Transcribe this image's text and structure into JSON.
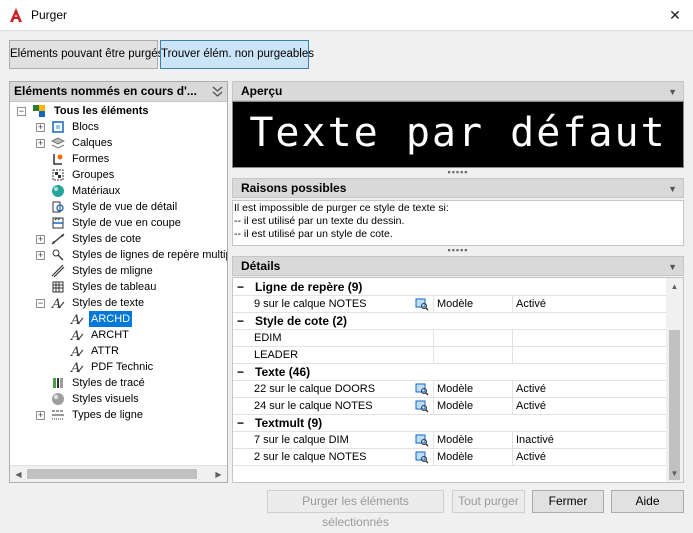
{
  "window": {
    "title": "Purger",
    "close_symbol": "✕"
  },
  "tabs": {
    "purgeable": {
      "pre": "Eléments pouvant être purgés",
      "underline": ""
    },
    "non_purgeable": {
      "label": "Trouver élém. non purgeables"
    }
  },
  "left_panel": {
    "header": "Eléments nommés en cours d'...",
    "root": "Tous les éléments",
    "items": [
      {
        "label": "Blocs"
      },
      {
        "label": "Calques"
      },
      {
        "label": "Formes"
      },
      {
        "label": "Groupes"
      },
      {
        "label": "Matériaux"
      },
      {
        "label": "Style de vue de détail"
      },
      {
        "label": "Style de vue en coupe"
      },
      {
        "label": "Styles de cote"
      },
      {
        "label": "Styles de lignes de repère multiple"
      },
      {
        "label": "Styles de mligne"
      },
      {
        "label": "Styles de tableau"
      },
      {
        "label": "Styles de texte"
      },
      {
        "label": "ARCHD"
      },
      {
        "label": "ARCHT"
      },
      {
        "label": "ATTR"
      },
      {
        "label": "PDF Technic"
      },
      {
        "label": "Styles de tracé"
      },
      {
        "label": "Styles visuels"
      },
      {
        "label": "Types de ligne"
      }
    ]
  },
  "preview": {
    "header": "Aperçu",
    "text": "Texte par défaut"
  },
  "reasons": {
    "header": "Raisons possibles",
    "line1": "Il est impossible de purger ce style de texte si:",
    "line2": "-- il est utilisé par un texte du dessin.",
    "line3": "-- il est utilisé par un style de cote."
  },
  "details": {
    "header": "Détails",
    "groups": [
      {
        "title": "Ligne de repère (9)",
        "rows": [
          {
            "name": "9 sur le calque NOTES",
            "space": "Modèle",
            "state": "Activé"
          }
        ]
      },
      {
        "title": "Style de cote (2)",
        "rows": [
          {
            "name": "EDIM",
            "space": "",
            "state": ""
          },
          {
            "name": "LEADER",
            "space": "",
            "state": ""
          }
        ]
      },
      {
        "title": "Texte (46)",
        "rows": [
          {
            "name": "22 sur le calque DOORS",
            "space": "Modèle",
            "state": "Activé"
          },
          {
            "name": "24 sur le calque NOTES",
            "space": "Modèle",
            "state": "Activé"
          }
        ]
      },
      {
        "title": "Textmult (9)",
        "rows": [
          {
            "name": "7 sur le calque DIM",
            "space": "Modèle",
            "state": "Inactivé"
          },
          {
            "name": "2 sur le calque NOTES",
            "space": "Modèle",
            "state": "Activé"
          }
        ]
      }
    ]
  },
  "buttons": {
    "purge_selected": "Purger les éléments sélectionnés",
    "purge_all": "Tout purger",
    "close": "Fermer",
    "help": "Aide"
  }
}
